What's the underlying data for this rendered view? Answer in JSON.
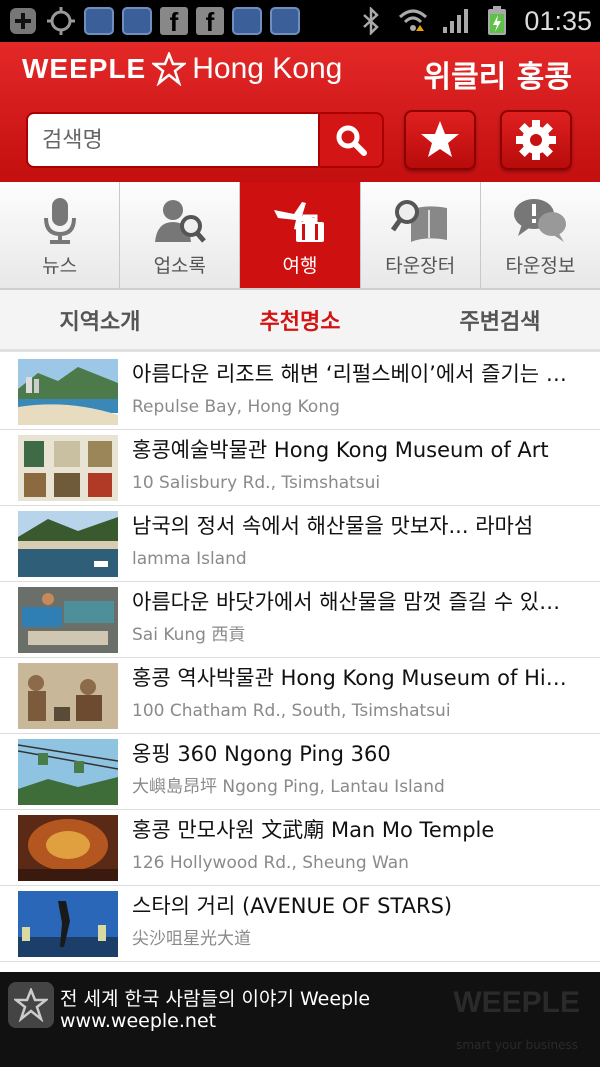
{
  "status_bar": {
    "time": "01:35",
    "colors": {
      "background": "#000000",
      "text": "#dddddd"
    }
  },
  "header": {
    "logo_brand": "WEEPLE",
    "logo_city": "Hong Kong",
    "weekly_title": "위클리 홍콩",
    "search_placeholder": "검색명",
    "search_icon": "magnifier",
    "favorites_icon": "star",
    "settings_icon": "gear",
    "colors": {
      "accent": "#d41515"
    }
  },
  "categories": [
    {
      "label": "뉴스",
      "icon": "microphone",
      "active": false
    },
    {
      "label": "업소록",
      "icon": "person-search",
      "active": false
    },
    {
      "label": "여행",
      "icon": "airplane-suitcase",
      "active": true
    },
    {
      "label": "타운장터",
      "icon": "search-book",
      "active": false
    },
    {
      "label": "타운정보",
      "icon": "speech-bubbles",
      "active": false
    }
  ],
  "subtabs": [
    {
      "label": "지역소개",
      "active": false
    },
    {
      "label": "추천명소",
      "active": true
    },
    {
      "label": "주변검색",
      "active": false
    }
  ],
  "places": [
    {
      "title": "아름다운 리조트 해변 ‘리펄스베이’에서 즐기는 여유",
      "subtitle": "Repulse Bay, Hong Kong",
      "thumb": "beach"
    },
    {
      "title": "홍콩예술박물관  Hong Kong Museum of Art",
      "subtitle": "10 Salisbury Rd., Tsimshatsui",
      "thumb": "art"
    },
    {
      "title": "남국의 정서 속에서 해산물을 맛보자... 라마섬",
      "subtitle": "lamma Island",
      "thumb": "harbor"
    },
    {
      "title": "아름다운 바닷가에서 해산물을 맘껏 즐길 수 있는 곳",
      "subtitle": "Sai Kung 西貢",
      "thumb": "market"
    },
    {
      "title": "홍콩 역사박물관  Hong Kong Museum of History",
      "subtitle": "100 Chatham Rd., South, Tsimshatsui",
      "thumb": "history"
    },
    {
      "title": "옹핑 360  Ngong Ping 360",
      "subtitle": "大嶼島昂坪 Ngong Ping, Lantau Island",
      "thumb": "cablecar"
    },
    {
      "title": "홍콩 만모사원 文武廟 Man Mo Temple",
      "subtitle": "126 Hollywood Rd., Sheung Wan",
      "thumb": "temple"
    },
    {
      "title": "스타의 거리 (AVENUE OF STARS)",
      "subtitle": "尖沙咀星光大道",
      "thumb": "stars"
    }
  ],
  "ad_banner": {
    "line1": "전 세계 한국 사람들의 이야기 Weeple",
    "line2": "www.weeple.net",
    "brand": "WEEPLE",
    "tagline": "smart your business"
  }
}
